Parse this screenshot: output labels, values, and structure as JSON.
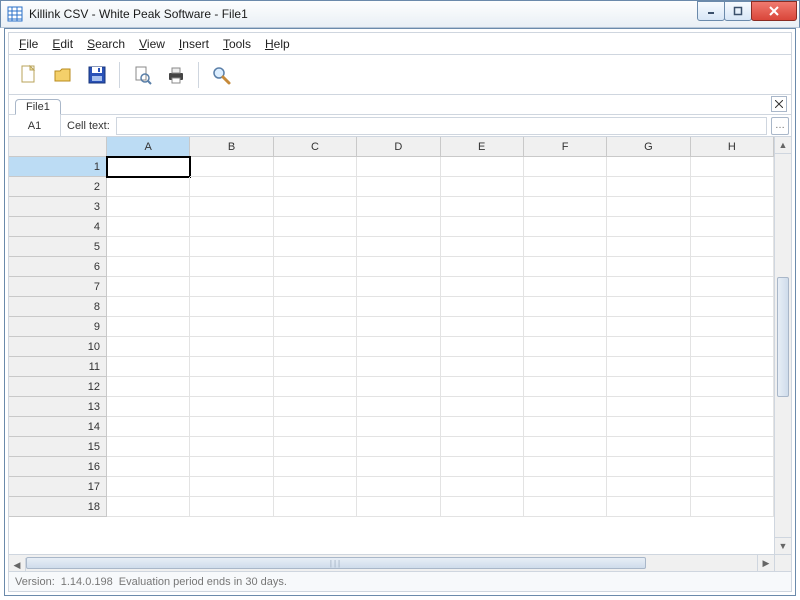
{
  "window": {
    "title": "Killink CSV - White Peak Software - File1"
  },
  "menu": {
    "file": "File",
    "edit": "Edit",
    "search": "Search",
    "view": "View",
    "insert": "Insert",
    "tools": "Tools",
    "help": "Help"
  },
  "tabs": {
    "active": "File1"
  },
  "refbar": {
    "cell_reference": "A1",
    "cell_text_label": "Cell text:",
    "cell_text_value": ""
  },
  "grid": {
    "columns": [
      "A",
      "B",
      "C",
      "D",
      "E",
      "F",
      "G",
      "H"
    ],
    "rows": [
      "1",
      "2",
      "3",
      "4",
      "5",
      "6",
      "7",
      "8",
      "9",
      "10",
      "11",
      "12",
      "13",
      "14",
      "15",
      "16",
      "17",
      "18"
    ],
    "active_col_index": 0,
    "active_row_index": 0
  },
  "status": {
    "version_label": "Version:",
    "version": "1.14.0.198",
    "eval_message": "Evaluation period ends in 30 days."
  }
}
